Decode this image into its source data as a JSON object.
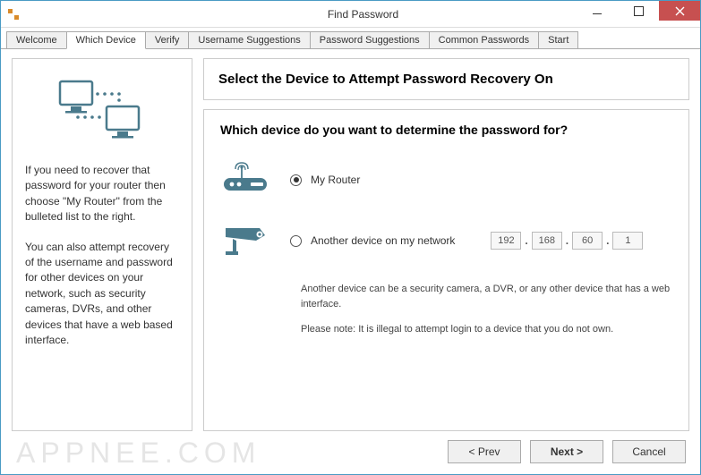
{
  "window": {
    "title": "Find Password"
  },
  "tabs": [
    {
      "label": "Welcome",
      "active": false
    },
    {
      "label": "Which Device",
      "active": true
    },
    {
      "label": "Verify",
      "active": false
    },
    {
      "label": "Username Suggestions",
      "active": false
    },
    {
      "label": "Password Suggestions",
      "active": false
    },
    {
      "label": "Common Passwords",
      "active": false
    },
    {
      "label": "Start",
      "active": false
    }
  ],
  "sidebar": {
    "para1": "If you need to recover that password for your router then choose \"My Router\" from the bulleted list to the right.",
    "para2": "You can also attempt recovery of the username and password for other devices on your network, such as security cameras, DVRs, and other devices that have a web based interface."
  },
  "header": {
    "title": "Select the Device to Attempt Password Recovery On"
  },
  "main": {
    "question": "Which device do you want to determine the password for?",
    "option1": {
      "label": "My Router",
      "checked": true
    },
    "option2": {
      "label": "Another device on my network",
      "checked": false
    },
    "ip": {
      "a": "192",
      "b": "168",
      "c": "60",
      "d": "1"
    },
    "note1": "Another device can be a security camera, a DVR, or any other device that has a web interface.",
    "note2": "Please note: It is illegal to attempt login to a device that you do not own."
  },
  "footer": {
    "prev": "< Prev",
    "next": "Next >",
    "cancel": "Cancel"
  },
  "watermark": "APPNEE.COM"
}
